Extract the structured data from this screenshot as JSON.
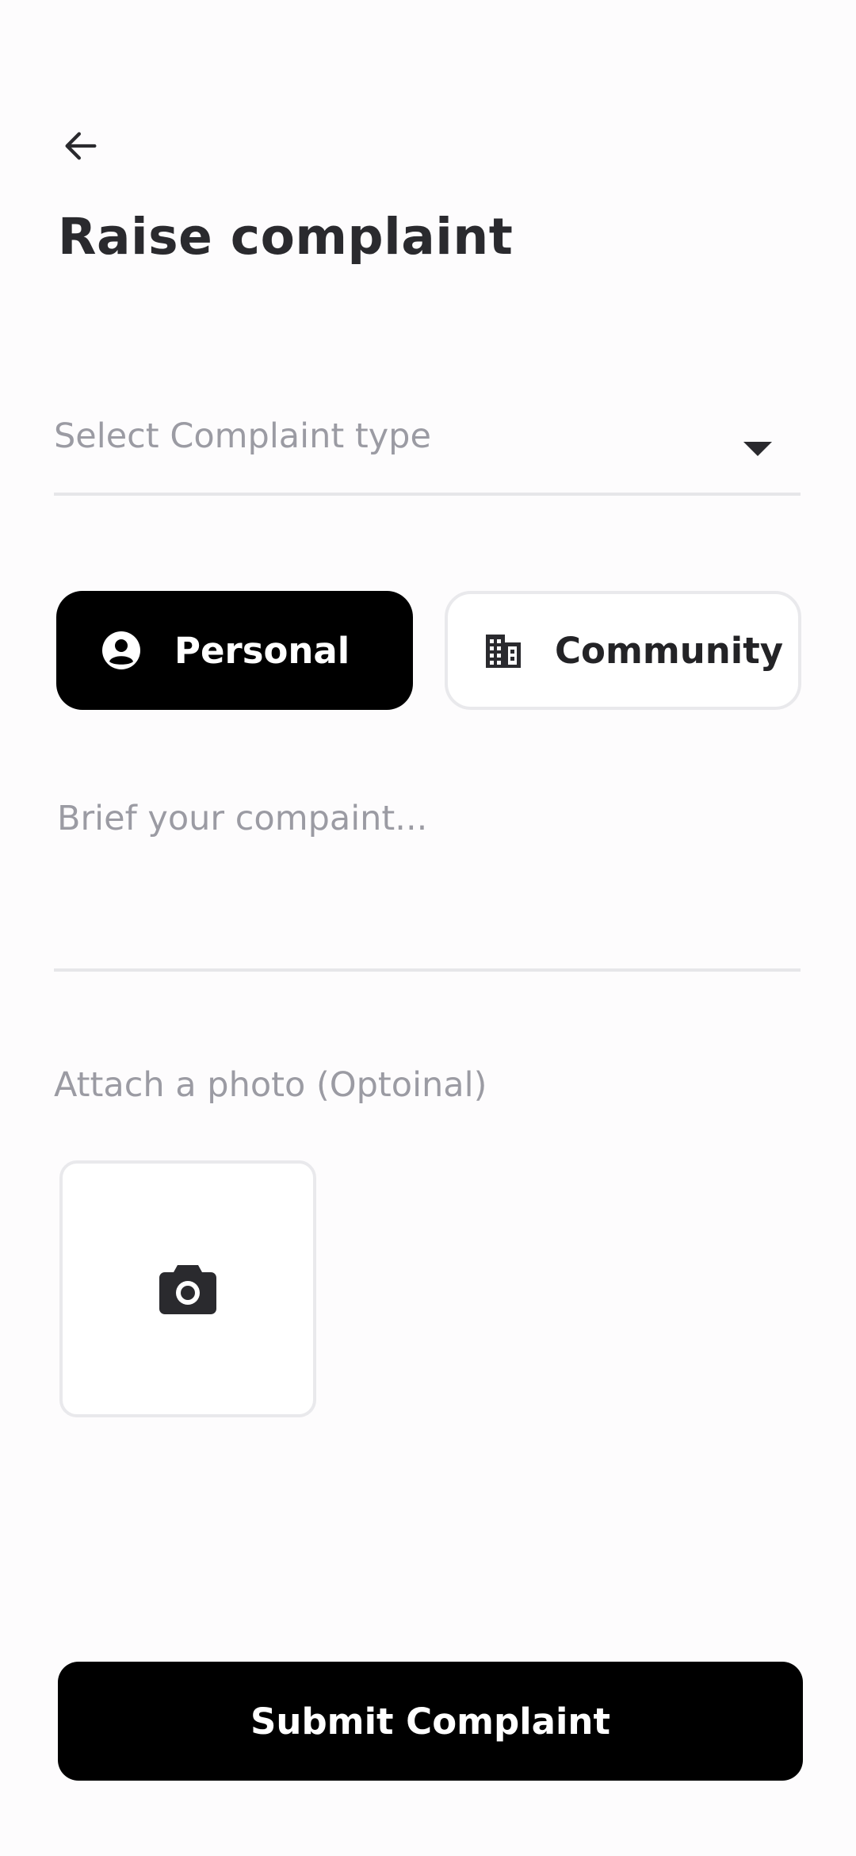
{
  "colors": {
    "background": "#fdfcfd",
    "primary": "#000000",
    "text": "#232326",
    "placeholder": "#9b9ba3",
    "divider": "#e6e6e9"
  },
  "header": {
    "back_icon": "arrow-left-icon",
    "title": "Raise complaint"
  },
  "form": {
    "complaint_type": {
      "placeholder": "Select Complaint type",
      "icon": "caret-down-icon"
    },
    "scope": {
      "selected": "Personal",
      "options": [
        {
          "label": "Personal",
          "icon": "person-circle-icon"
        },
        {
          "label": "Community",
          "icon": "building-icon"
        }
      ]
    },
    "description": {
      "placeholder": "Brief your compaint..."
    },
    "attachment": {
      "label": "Attach a photo (Optoinal)",
      "icon": "camera-icon"
    }
  },
  "footer": {
    "submit_label": "Submit Complaint"
  }
}
